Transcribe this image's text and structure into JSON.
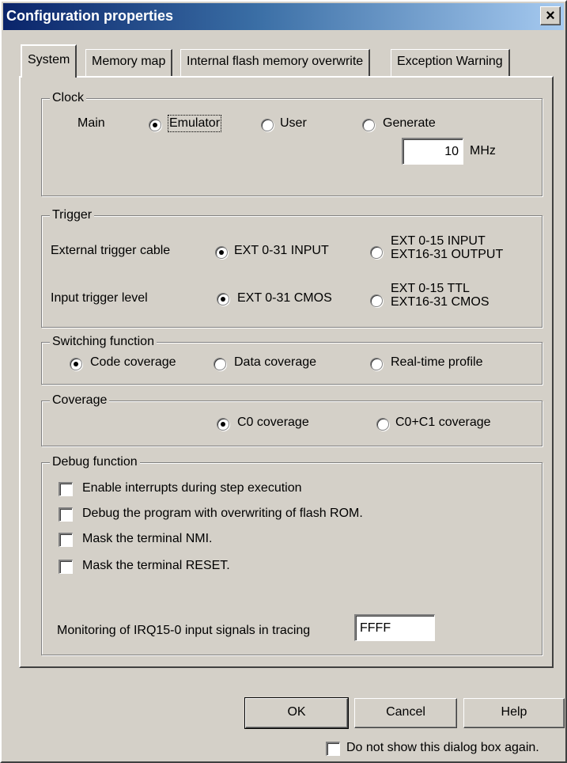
{
  "window": {
    "title": "Configuration properties",
    "close_glyph": "×"
  },
  "tabs": [
    {
      "label": "System"
    },
    {
      "label": "Memory map"
    },
    {
      "label": "Internal flash memory overwrite"
    },
    {
      "label": "Exception Warning"
    }
  ],
  "clock": {
    "group_label": "Clock",
    "main_label": "Main",
    "options": [
      "Emulator",
      "User",
      "Generate"
    ],
    "selected": "Emulator",
    "frequency_value": "10",
    "frequency_unit": "MHz"
  },
  "trigger": {
    "group_label": "Trigger",
    "external_cable_label": "External trigger cable",
    "cable_option_1": "EXT 0-31  INPUT",
    "cable_option_2_line1": "EXT 0-15  INPUT",
    "cable_option_2_line2": "EXT16-31  OUTPUT",
    "input_level_label": "Input trigger level",
    "level_option_1": "EXT 0-31  CMOS",
    "level_option_2_line1": "EXT 0-15  TTL",
    "level_option_2_line2": "EXT16-31  CMOS"
  },
  "switching": {
    "group_label": "Switching function",
    "options": [
      "Code coverage",
      "Data coverage",
      "Real-time profile"
    ],
    "selected": "Code coverage"
  },
  "coverage": {
    "group_label": "Coverage",
    "options": [
      "C0 coverage",
      "C0+C1 coverage"
    ],
    "selected": "C0 coverage"
  },
  "debug": {
    "group_label": "Debug function",
    "checkboxes": [
      {
        "label": "Enable interrupts during step execution",
        "checked": false
      },
      {
        "label": "Debug the program with overwriting of flash ROM.",
        "checked": false
      },
      {
        "label": "Mask the terminal NMI.",
        "checked": false
      },
      {
        "label": "Mask the terminal RESET.",
        "checked": false
      }
    ],
    "irq_label": "Monitoring of IRQ15-0 input signals in tracing",
    "irq_value": "FFFF"
  },
  "buttons": {
    "ok": "OK",
    "cancel": "Cancel",
    "help": "Help"
  },
  "footer": {
    "dont_show_label": "Do not show this dialog box again.",
    "checked": false
  }
}
